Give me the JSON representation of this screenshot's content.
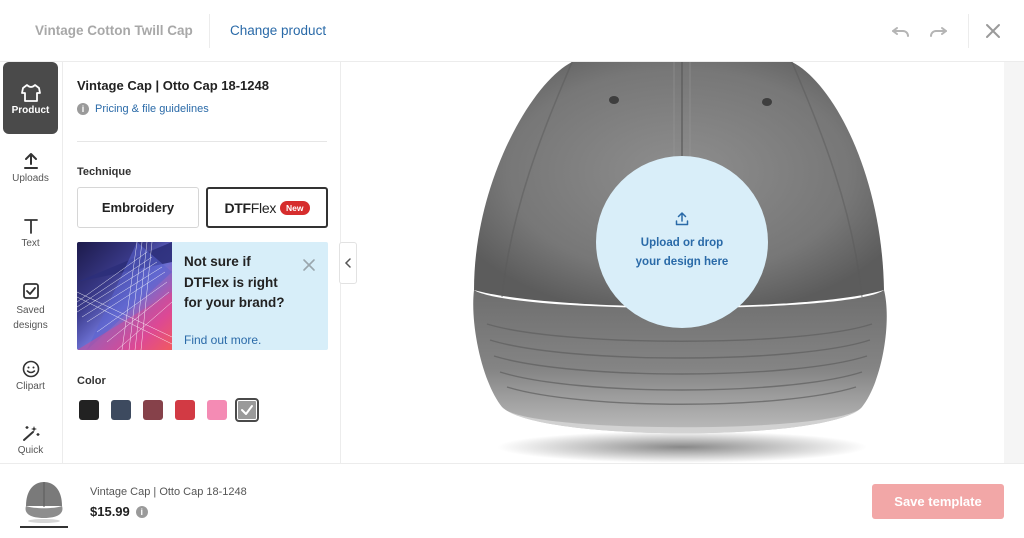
{
  "header": {
    "product_title": "Vintage Cotton Twill Cap",
    "change_product": "Change product"
  },
  "rail": {
    "items": [
      {
        "label": "Product",
        "icon": "tshirt-icon",
        "active": true
      },
      {
        "label": "Uploads",
        "icon": "upload-icon"
      },
      {
        "label": "Text",
        "icon": "text-icon"
      },
      {
        "label": "Saved designs",
        "label_line1": "Saved",
        "label_line2": "designs",
        "icon": "saved-designs-icon"
      },
      {
        "label": "Clipart",
        "icon": "smiley-icon"
      },
      {
        "label": "Quick",
        "icon": "magic-wand-icon"
      }
    ]
  },
  "panel": {
    "title": "Vintage Cap | Otto Cap 18-1248",
    "guidelines_link": "Pricing & file guidelines",
    "technique_label": "Technique",
    "techniques": [
      {
        "label": "Embroidery",
        "selected": false
      },
      {
        "label_bold": "DTF",
        "label_thin": "lex",
        "label_letter": "F",
        "badge": "New",
        "selected": true
      }
    ],
    "promo": {
      "text": "Not sure if DTFlex is right for your brand?",
      "link": "Find out more."
    },
    "color_label": "Color",
    "colors": [
      "#222222",
      "#3d4a5f",
      "#86414a",
      "#d23a44",
      "#f48bb4",
      "#9a9a9a"
    ],
    "selected_color_index": 5
  },
  "canvas": {
    "upload_text_line1": "Upload or drop",
    "upload_text_line2": "your design here",
    "cap_color": "#7d7d7d"
  },
  "footer": {
    "product_name": "Vintage Cap | Otto Cap 18-1248",
    "price": "$15.99",
    "save_button": "Save template"
  },
  "colors": {
    "accent_link": "#2a6aa8",
    "save_button_bg": "#f2a7a7",
    "promo_bg": "#d7eef9",
    "upload_bg": "#d9eef9",
    "new_badge": "#d62d2d"
  }
}
